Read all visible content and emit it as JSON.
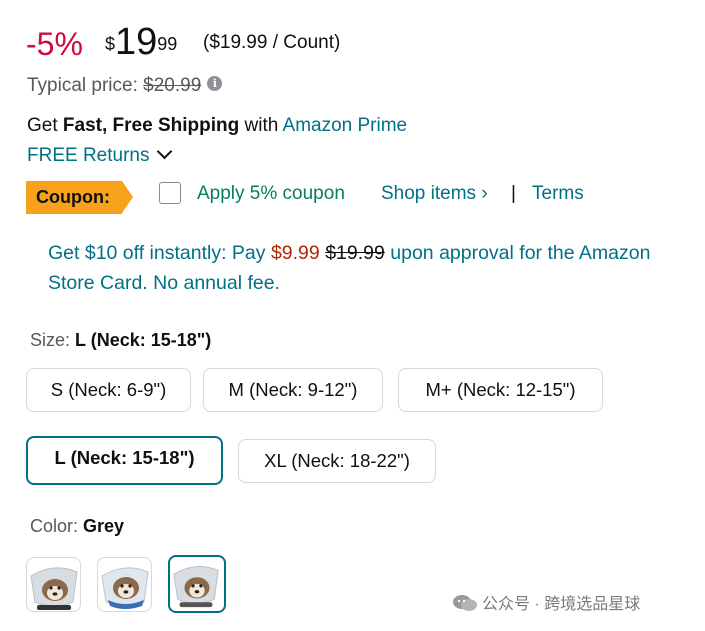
{
  "price": {
    "discount": "-5%",
    "currency_symbol": "$",
    "whole": "19",
    "fraction": "99",
    "per_unit": "($19.99 / Count)"
  },
  "typical_price": {
    "label": "Typical price:",
    "value": "$20.99",
    "info_icon": "info-icon"
  },
  "shipping": {
    "prefix": "Get",
    "bold": "Fast, Free Shipping",
    "mid": "with",
    "link": "Amazon Prime"
  },
  "returns": {
    "label": "FREE Returns",
    "icon": "chevron-down-icon"
  },
  "coupon": {
    "badge": "Coupon:",
    "checkbox_label": "Apply 5% coupon",
    "shop_items": "Shop items ›",
    "separator": "|",
    "terms": "Terms",
    "badge_color": "#f7a21a"
  },
  "store_card": {
    "line1_prefix": "Get $10 off instantly: Pay",
    "new_price": "$9.99",
    "old_price": "$19.99",
    "line1_suffix": "upon approval for the",
    "line2": "Amazon Store Card. No annual fee."
  },
  "size": {
    "label": "Size:",
    "selected": "L (Neck: 15-18\")",
    "options": [
      {
        "label": "S (Neck: 6-9\")"
      },
      {
        "label": "M (Neck: 9-12\")"
      },
      {
        "label": "M+ (Neck: 12-15\")"
      },
      {
        "label": "L (Neck: 15-18\")"
      },
      {
        "label": "XL (Neck: 18-22\")"
      }
    ]
  },
  "color": {
    "label": "Color:",
    "selected": "Grey",
    "swatches": [
      "grey-cone-dog",
      "blue-cone-dog",
      "grey-cone-dog-selected"
    ]
  },
  "watermark": "公众号 · 跨境选品星球",
  "colors": {
    "discount_red": "#cc0c39",
    "link_teal": "#007185",
    "coupon_green": "#067d62",
    "price_red": "#b12704",
    "selected_border": "#007185"
  }
}
